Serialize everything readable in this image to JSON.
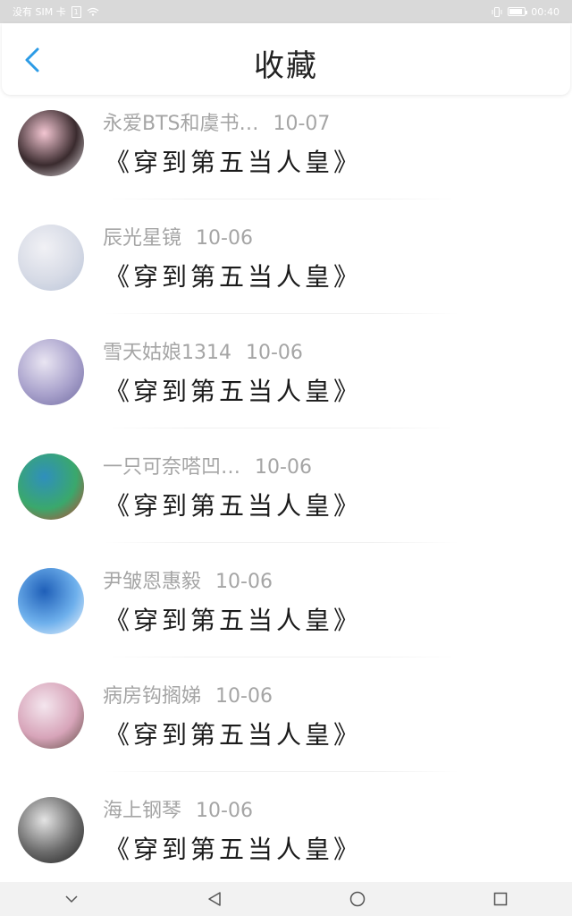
{
  "status_bar": {
    "carrier": "没有 SIM 卡",
    "time": "00:40",
    "battery_level": 0.85
  },
  "header": {
    "title": "收藏",
    "back_icon": "chevron-left-icon"
  },
  "items": [
    {
      "username": "永爱BTS和虞书…",
      "date": "10-07",
      "content": "《穿到第五当人皇》",
      "avatar_colors": [
        "#f3c6d2",
        "#3a2b2e",
        "#e7e2e6"
      ]
    },
    {
      "username": "辰光星镜",
      "date": "10-06",
      "content": "《穿到第五当人皇》",
      "avatar_colors": [
        "#f1f1f5",
        "#d7dbe6",
        "#b9c4d8"
      ]
    },
    {
      "username": "雪天姑娘1314",
      "date": "10-06",
      "content": "《穿到第五当人皇》",
      "avatar_colors": [
        "#e9e5f2",
        "#a9a2cc",
        "#6f6aa0"
      ]
    },
    {
      "username": "一只可奈嗒凹…",
      "date": "10-06",
      "content": "《穿到第五当人皇》",
      "avatar_colors": [
        "#2f8fbd",
        "#3aa86c",
        "#c8402f"
      ]
    },
    {
      "username": "尹皱恩惠毅",
      "date": "10-06",
      "content": "《穿到第五当人皇》",
      "avatar_colors": [
        "#1f5fb8",
        "#6eb0ec",
        "#f4f8fd"
      ]
    },
    {
      "username": "病房钩搁娣",
      "date": "10-06",
      "content": "《穿到第五当人皇》",
      "avatar_colors": [
        "#f4e6ee",
        "#d7a4b9",
        "#5d4a41"
      ]
    },
    {
      "username": "海上钢琴",
      "date": "10-06",
      "content": "《穿到第五当人皇》",
      "avatar_colors": [
        "#e4e4e4",
        "#6b6b6b",
        "#1e1e1e"
      ]
    }
  ],
  "nav_bar": {
    "icons": [
      "chevron-down-icon",
      "back-triangle-icon",
      "home-circle-icon",
      "recents-square-icon"
    ]
  }
}
